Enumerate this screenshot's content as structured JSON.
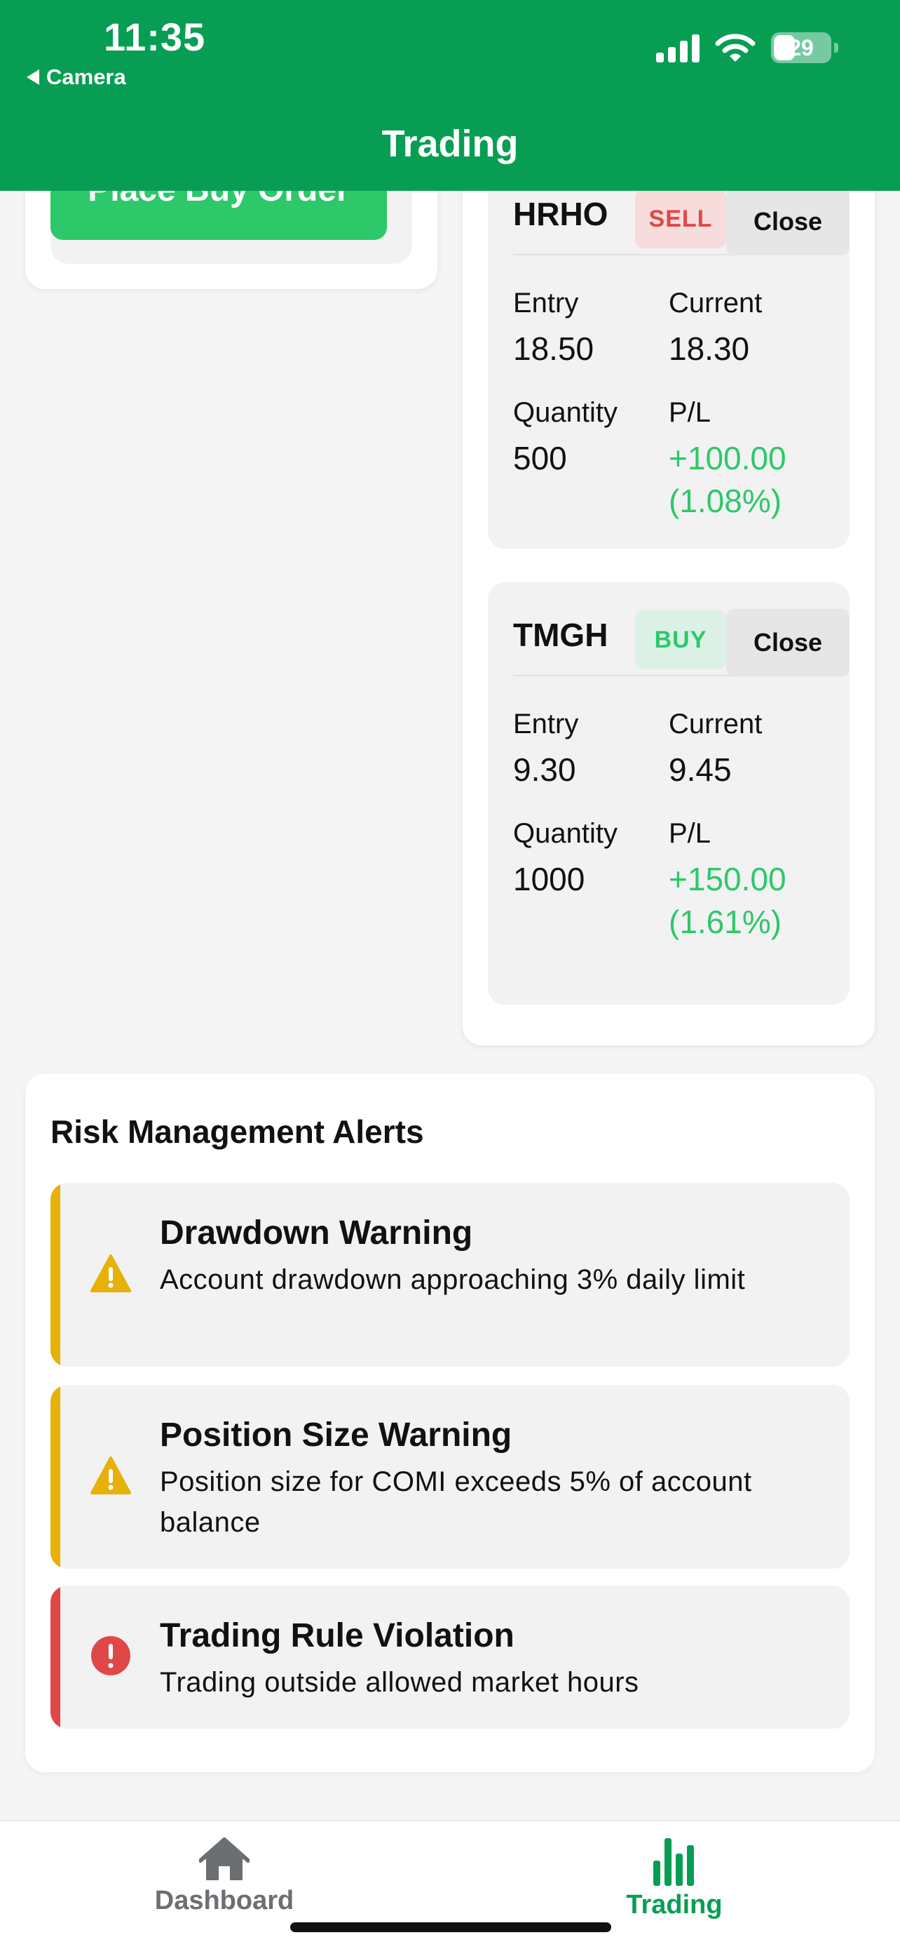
{
  "status_bar": {
    "time": "11:35",
    "back_app": "Camera",
    "battery": "29"
  },
  "header": {
    "title": "Trading"
  },
  "order_form": {
    "submit_label": "Place Buy Order"
  },
  "positions": [
    {
      "symbol": "HRHO",
      "side": "SELL",
      "close_label": "Close",
      "entry_label": "Entry",
      "entry": "18.50",
      "current_label": "Current",
      "current": "18.30",
      "quantity_label": "Quantity",
      "quantity": "500",
      "pl_label": "P/L",
      "pl_value": "+100.00",
      "pl_percent": "(1.08%)"
    },
    {
      "symbol": "TMGH",
      "side": "BUY",
      "close_label": "Close",
      "entry_label": "Entry",
      "entry": "9.30",
      "current_label": "Current",
      "current": "9.45",
      "quantity_label": "Quantity",
      "quantity": "1000",
      "pl_label": "P/L",
      "pl_value": "+150.00",
      "pl_percent": "(1.61%)"
    }
  ],
  "risk": {
    "title": "Risk Management Alerts",
    "alerts": [
      {
        "level": "warning",
        "icon": "warning-triangle-icon",
        "title": "Drawdown Warning",
        "message": "Account drawdown approaching 3% daily limit"
      },
      {
        "level": "warning",
        "icon": "warning-triangle-icon",
        "title": "Position Size Warning",
        "message": "Position size for COMI exceeds 5% of account balance"
      },
      {
        "level": "error",
        "icon": "error-circle-icon",
        "title": "Trading Rule Violation",
        "message": "Trading outside allowed market hours"
      }
    ]
  },
  "tabbar": {
    "tabs": [
      {
        "label": "Dashboard",
        "icon": "home-icon",
        "active": false
      },
      {
        "label": "Trading",
        "icon": "bar-chart-icon",
        "active": true
      }
    ]
  },
  "colors": {
    "header": "#079e54",
    "accent": "#2dc86a",
    "sell": "#e04848",
    "warning": "#e7b10a",
    "error": "#e04848",
    "inactive_tab": "#6b6e72"
  }
}
